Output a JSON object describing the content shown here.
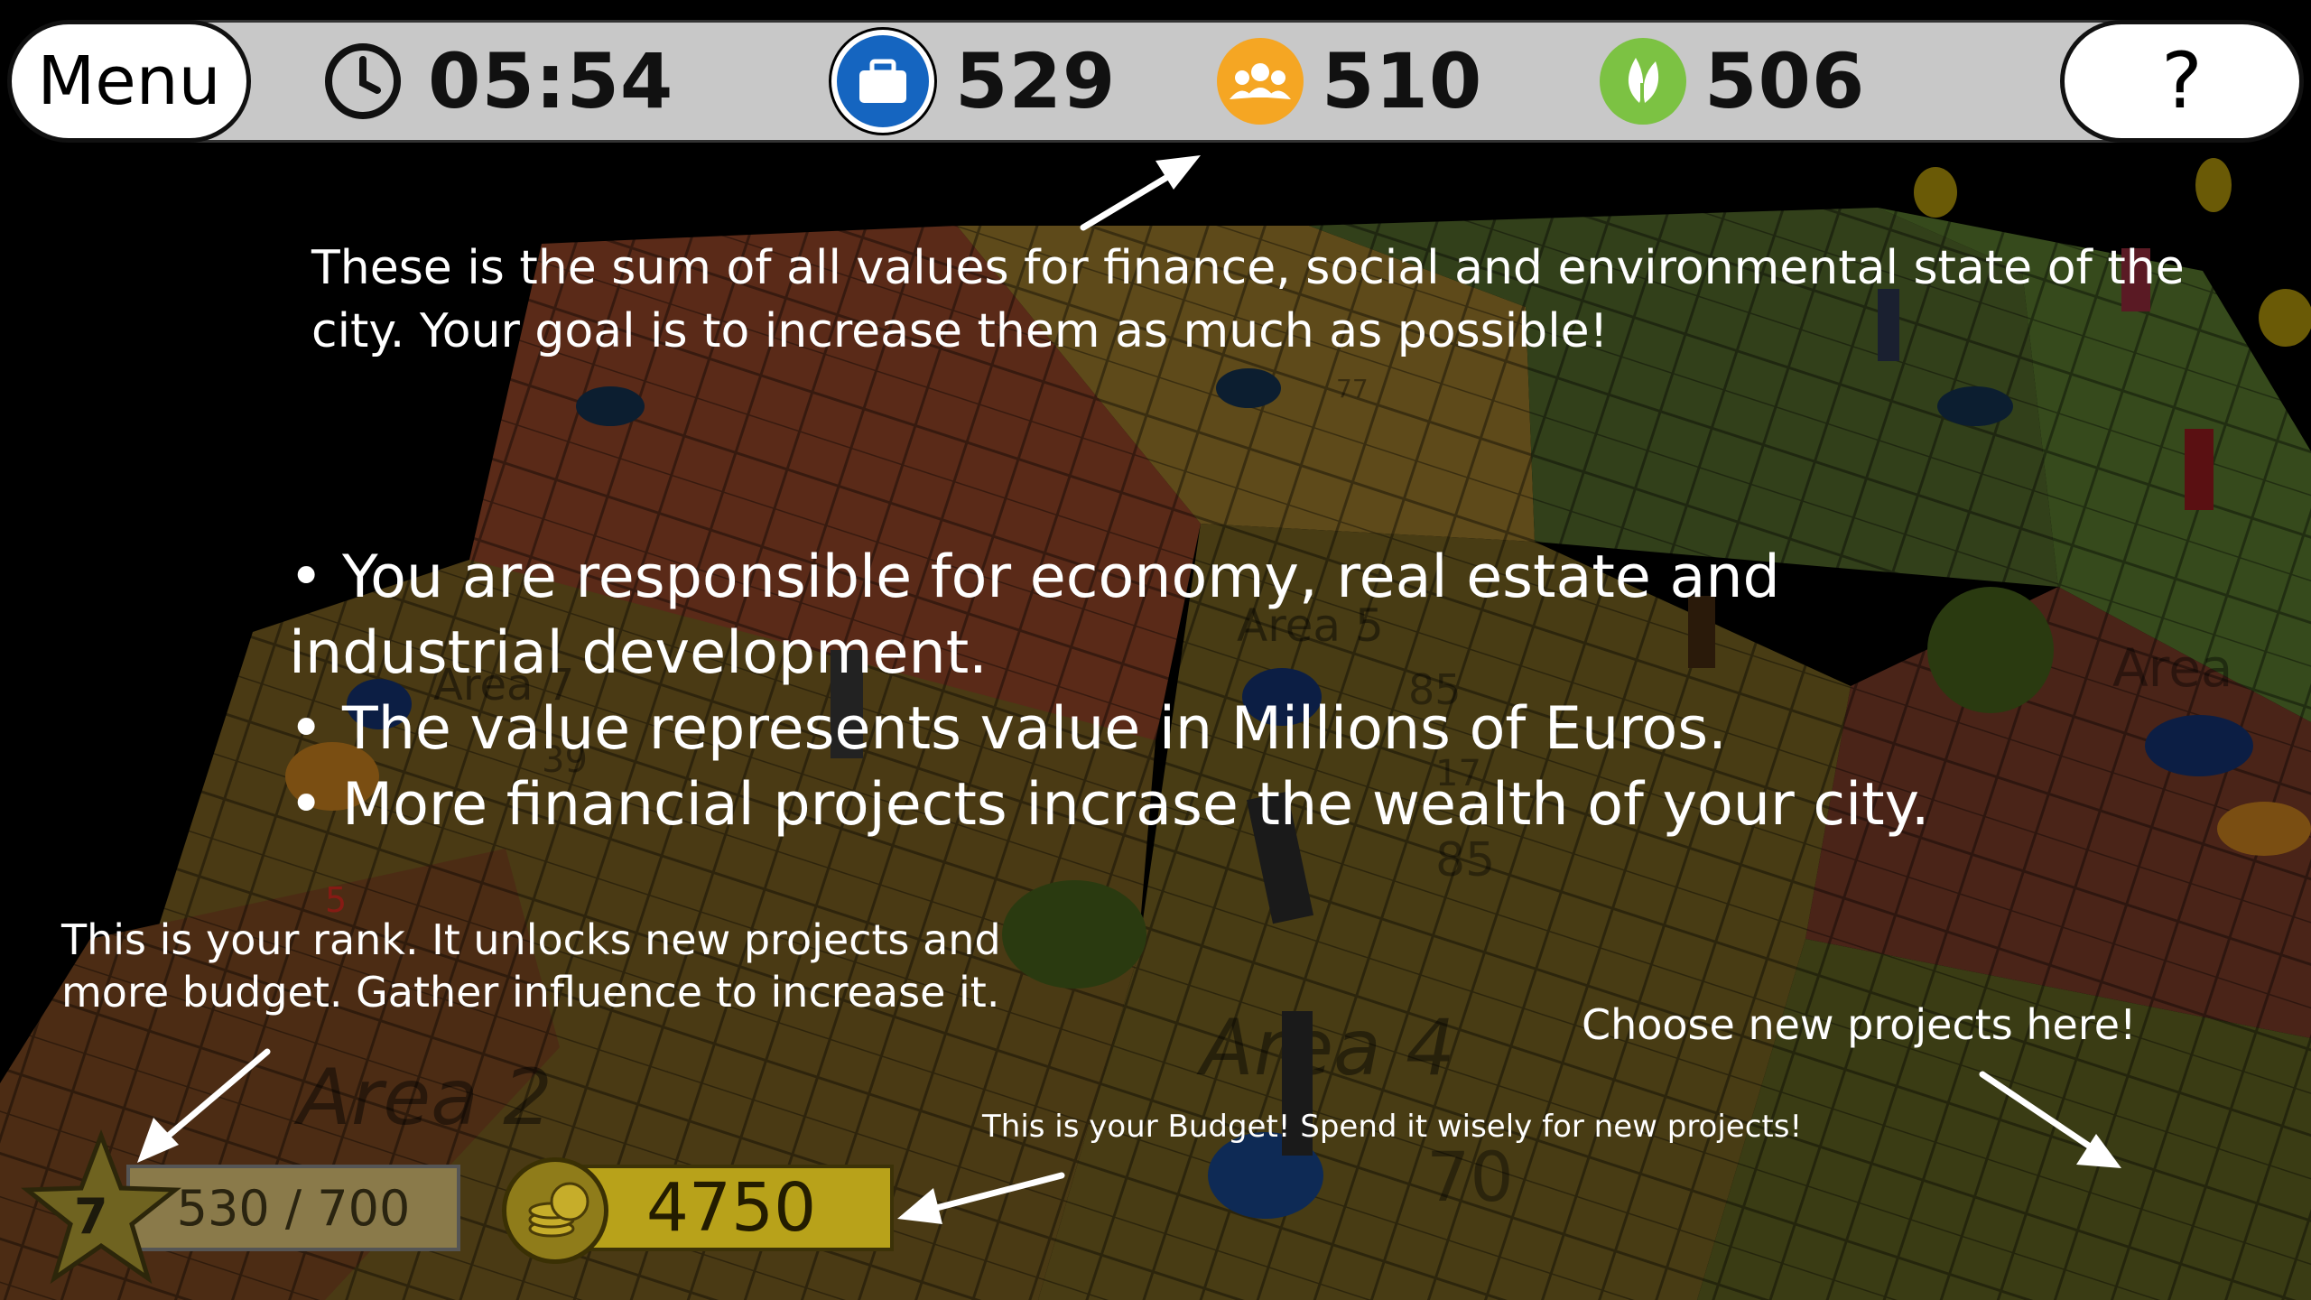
{
  "topbar": {
    "menu_label": "Menu",
    "timer": "05:54",
    "finance_value": "529",
    "social_value": "510",
    "environment_value": "506",
    "help_label": "?"
  },
  "icons": {
    "timer": "clock-icon",
    "finance": "briefcase-icon",
    "social": "people-icon",
    "environment": "leaf-icon",
    "rank": "star-icon",
    "budget": "coins-icon"
  },
  "colors": {
    "finance": "#1565c0",
    "social": "#f5a623",
    "environment": "#7cc243",
    "budget": "#b8a21a"
  },
  "tutorial": {
    "totals_hint": "These is the sum of all values for finance, social and environmental state of the city. Your goal is to increase them as much as possible!",
    "bullet_1": "• You are responsible for economy, real estate and industrial development.",
    "bullet_2": "• The value represents value in Millions of Euros.",
    "bullet_3": "• More financial projects incrase the wealth of your city.",
    "rank_hint": "This is your rank. It unlocks new projects and more budget. Gather influence to increase it.",
    "budget_hint": "This is your Budget! Spend it wisely for new projects!",
    "projects_hint": "Choose new projects here!"
  },
  "hud": {
    "rank_level": "7",
    "influence_progress": "530 / 700",
    "budget": "4750"
  },
  "map": {
    "area_labels": [
      "Area 2",
      "Area 4",
      "Area 5",
      "Area 7",
      "Area"
    ],
    "area_values": [
      "85",
      "85",
      "70",
      "77",
      "17",
      "39",
      "5"
    ]
  }
}
